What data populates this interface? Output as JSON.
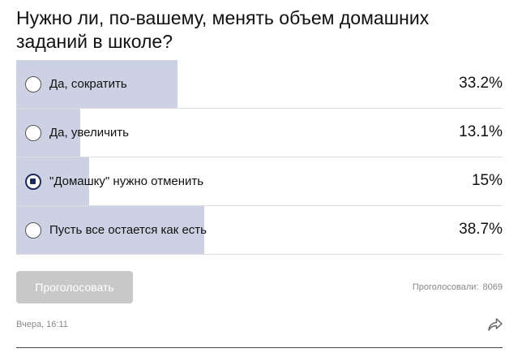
{
  "poll": {
    "question": "Нужно ли, по-вашему, менять объем домашних заданий в школе?",
    "options": [
      {
        "label": "Да, сократить",
        "percent_label": "33.2%",
        "percent": 33.2,
        "selected": false
      },
      {
        "label": "Да, увеличить",
        "percent_label": "13.1%",
        "percent": 13.1,
        "selected": false
      },
      {
        "label": "\"Домашку\" нужно отменить",
        "percent_label": "15%",
        "percent": 15,
        "selected": true
      },
      {
        "label": "Пусть все остается как есть",
        "percent_label": "38.7%",
        "percent": 38.7,
        "selected": false
      }
    ],
    "vote_button_label": "Проголосовать",
    "voted_label": "Проголосовали:",
    "voted_count": "8069",
    "timestamp": "Вчера, 16:11",
    "bar_color": "#ccd2e3",
    "selected_color": "#1d2a5b"
  },
  "icons": {
    "share": "share-icon"
  }
}
